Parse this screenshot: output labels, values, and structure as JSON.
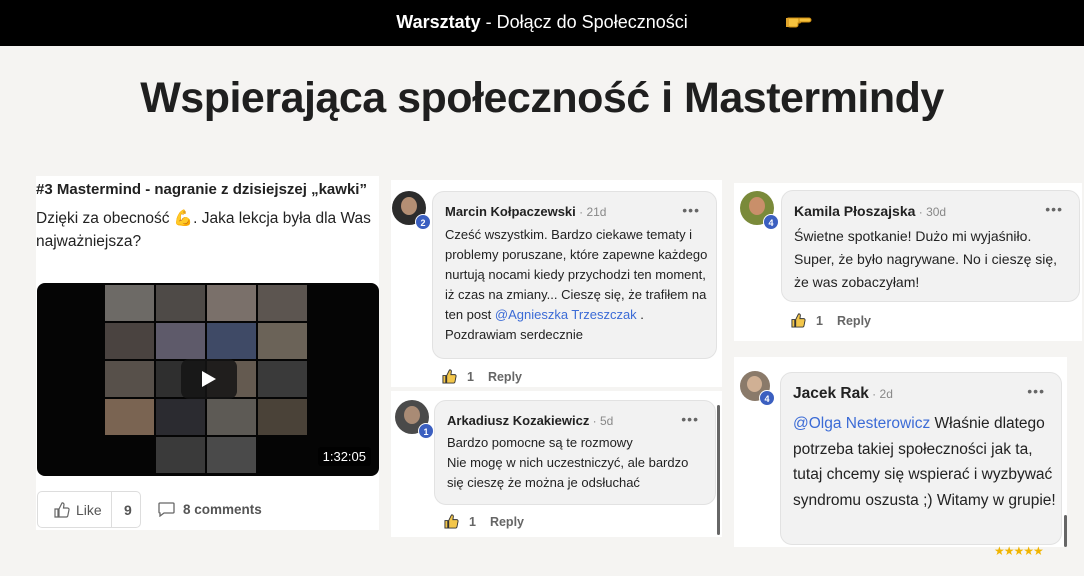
{
  "topbar": {
    "brand": "Warsztaty",
    "separator": " - ",
    "cta": "Dołącz do Społeczności",
    "cta_icon": "pointing-hand-icon"
  },
  "headline": "Wspierająca społeczność i Mastermindy",
  "post": {
    "title": "#3 Mastermind - nagranie z dzisiejszej „kawki”",
    "body": "Dzięki za obecność 💪. Jaka lekcja była dla Was najważniejsza?",
    "video_duration": "1:32:05",
    "like_label": "Like",
    "like_count": "9",
    "comments_label": "8 comments"
  },
  "comments": [
    {
      "author": "Marcin Kołpaczewski",
      "time": "21d",
      "badge": "2",
      "text_before": "Cześć wszystkim. Bardzo ciekawe tematy i problemy poruszane, które zapewne każdego nurtują nocami kiedy przychodzi ten moment, iż czas na zmiany... Cieszę się, że trafiłem na ten post ",
      "mention": "@Agnieszka Trzeszczak",
      "text_after": " . Pozdrawiam serdecznie",
      "likes": "1",
      "reply": "Reply"
    },
    {
      "author": "Arkadiusz Kozakiewicz",
      "time": "5d",
      "badge": "1",
      "line1": "Bardzo pomocne są te rozmowy",
      "line2": "Nie mogę w nich uczestniczyć, ale bardzo",
      "line3": "się cieszę że można je odsłuchać",
      "likes": "1",
      "reply": "Reply"
    },
    {
      "author": "Kamila Płoszajska",
      "time": "30d",
      "badge": "4",
      "text": "Świetne spotkanie! Dużo mi wyjaśniło. Super, że było nagrywane. No i cieszę się, że was zobaczyłam!",
      "likes": "1",
      "reply": "Reply"
    },
    {
      "author": "Jacek Rak",
      "time": "2d",
      "badge": "4",
      "mention": "@Olga Nesterowicz",
      "text_after": " Właśnie dlatego potrzeba takiej społeczności jak ta, tutaj chcemy się wspierać i wyzbywać syndromu oszusta ;) Witamy w grupie!"
    }
  ],
  "time_sep": " · ",
  "menu_glyph": "•••",
  "stars": "★★★★★",
  "colors": {
    "accent": "#3b6bd6",
    "badge": "#3b5fc0",
    "topbar": "#000000"
  }
}
